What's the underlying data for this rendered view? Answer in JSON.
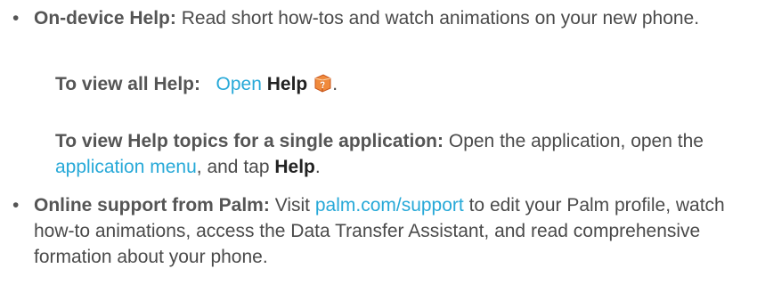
{
  "items": [
    {
      "bullet": "•",
      "label": "On-device Help:",
      "text": "Read short how-tos and watch animations on your new phone."
    },
    {
      "bullet": "•",
      "label": "Online support from Palm:",
      "text_before": "Visit",
      "link": "palm.com/support",
      "text_after": "to edit your Palm profile, watch how-to animations, access the Data Transfer Assistant, and read comprehensive formation about your phone."
    }
  ],
  "view_all": {
    "label": "To view all Help:",
    "link": "Open",
    "target": "Help",
    "end": ".",
    "icon": "help-book-icon"
  },
  "view_topics": {
    "label": "To view Help topics for a single application:",
    "text1": "Open the application,",
    "text2": "open the",
    "link": "application menu",
    "text3": ", and tap",
    "target": "Help",
    "end": "."
  },
  "colors": {
    "link": "#27a9d8",
    "body_text": "#4a4a4a",
    "icon_orange": "#e8793a"
  }
}
